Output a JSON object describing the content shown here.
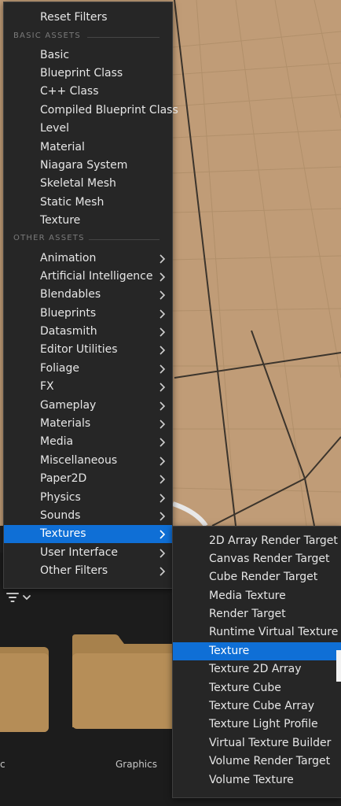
{
  "main_menu": {
    "reset_label": "Reset Filters",
    "basic_header": "BASIC ASSETS",
    "basic_items": [
      "Basic",
      "Blueprint Class",
      "C++ Class",
      "Compiled Blueprint Class",
      "Level",
      "Material",
      "Niagara System",
      "Skeletal Mesh",
      "Static Mesh",
      "Texture"
    ],
    "other_header": "OTHER ASSETS",
    "other_items": [
      "Animation",
      "Artificial Intelligence",
      "Blendables",
      "Blueprints",
      "Datasmith",
      "Editor Utilities",
      "Foliage",
      "FX",
      "Gameplay",
      "Materials",
      "Media",
      "Miscellaneous",
      "Paper2D",
      "Physics",
      "Sounds",
      "Textures",
      "User Interface",
      "Other Filters"
    ],
    "selected": "Textures"
  },
  "sub_menu": {
    "items": [
      "2D Array Render Target",
      "Canvas Render Target",
      "Cube Render Target",
      "Media Texture",
      "Render Target",
      "Runtime Virtual Texture",
      "Texture",
      "Texture 2D Array",
      "Texture Cube",
      "Texture Cube Array",
      "Texture Light Profile",
      "Virtual Texture Builder",
      "Volume Render Target",
      "Volume Texture"
    ],
    "selected": "Texture"
  },
  "content": {
    "folder_labels": [
      "c",
      "Graphics"
    ]
  },
  "colors": {
    "menu_bg": "#262626",
    "selection": "#0f6fd6",
    "floor": "#c19e79",
    "folder": "#b48a52"
  },
  "icons": {
    "filter": "filter-icon",
    "chevron": "chevron-right-icon",
    "dropdown": "chevron-down-icon"
  }
}
